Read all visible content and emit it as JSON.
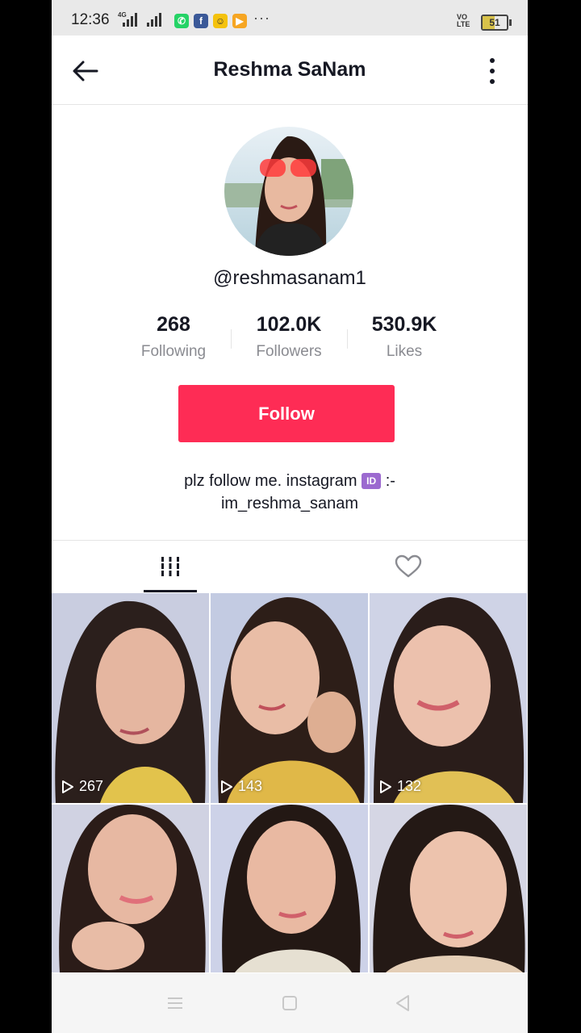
{
  "status_bar": {
    "time": "12:36",
    "network_tag": "4G",
    "volte_line1": "VO",
    "volte_line2": "LTE",
    "battery": "51",
    "overflow": "···"
  },
  "header": {
    "title": "Reshma SaNam"
  },
  "profile": {
    "username": "@reshmasanam1",
    "stats": [
      {
        "value": "268",
        "label": "Following"
      },
      {
        "value": "102.0K",
        "label": "Followers"
      },
      {
        "value": "530.9K",
        "label": "Likes"
      }
    ],
    "follow_label": "Follow",
    "bio_line1": "plz follow me. instagram",
    "bio_badge": "ID",
    "bio_suffix": ":-",
    "bio_line2": "im_reshma_sanam"
  },
  "tabs": [
    {
      "icon": "video-grid-icon",
      "selected": true
    },
    {
      "icon": "heart-icon",
      "selected": false
    }
  ],
  "videos": [
    {
      "views": "267"
    },
    {
      "views": "143"
    },
    {
      "views": "132"
    },
    {
      "views": ""
    },
    {
      "views": ""
    },
    {
      "views": ""
    }
  ],
  "colors": {
    "follow_button": "#fe2c55",
    "text_primary": "#161823",
    "text_secondary": "#8a8b91"
  }
}
